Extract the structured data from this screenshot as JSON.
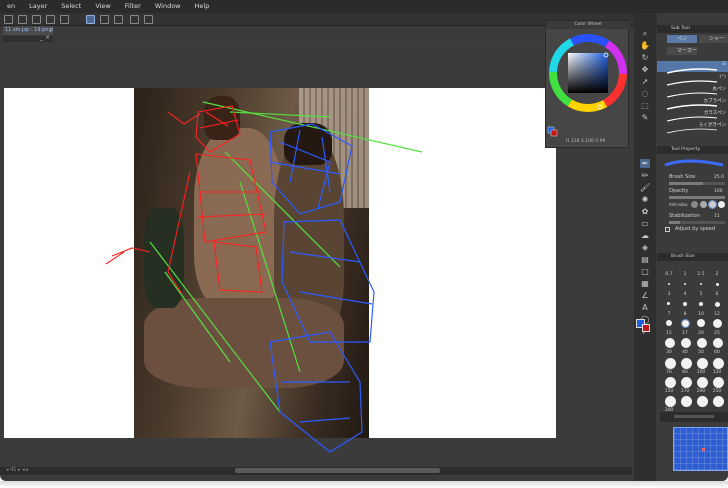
{
  "menu": [
    "en",
    "Layer",
    "Select",
    "View",
    "Filter",
    "Window",
    "Help"
  ],
  "document_tab": "11 sm.jsp - 19.png*",
  "document_tab_close": "×",
  "mini_bar_close": "_ ×",
  "status": "◂ 41 ▸ ◂ ▸",
  "color_wheel": {
    "title": "Color Wheel",
    "values": "H 218  S 100  V 99",
    "accent": "#3b5fff"
  },
  "subtool_panel": {
    "title": "Sub Tool",
    "tabs": [
      "ペン",
      "シャー",
      "マーカー"
    ],
    "brushes": [
      "G",
      "ｲ°ﾝ",
      "丸ペン",
      "カブラペン",
      "ガラスペン",
      "らくがきペン"
    ]
  },
  "tool_property": {
    "title": "Tool Property",
    "rows": [
      {
        "label": "Brush Size",
        "value": "25.0"
      },
      {
        "label": "Opacity",
        "value": "100"
      },
      {
        "label": "Anti-alias",
        "value": ""
      },
      {
        "label": "Stabilization",
        "value": "11"
      }
    ],
    "checkbox_label": "Adjust by speed"
  },
  "brush_size": {
    "title": "Brush Size",
    "labels": [
      "0.7",
      "1",
      "1.5",
      "2",
      "3",
      "4",
      "5",
      "6",
      "7",
      "8",
      "10",
      "12",
      "15",
      "17",
      "20",
      "25",
      "30",
      "40",
      "50",
      "60",
      "70",
      "80",
      "100",
      "120",
      "150",
      "170",
      "200",
      "250",
      "300"
    ]
  },
  "colors": {
    "main": "#1f5fe0",
    "sub": "#c01818",
    "red_sketch": "#ff2020",
    "blue_sketch": "#2a5cff",
    "green_sketch": "#55e040"
  }
}
